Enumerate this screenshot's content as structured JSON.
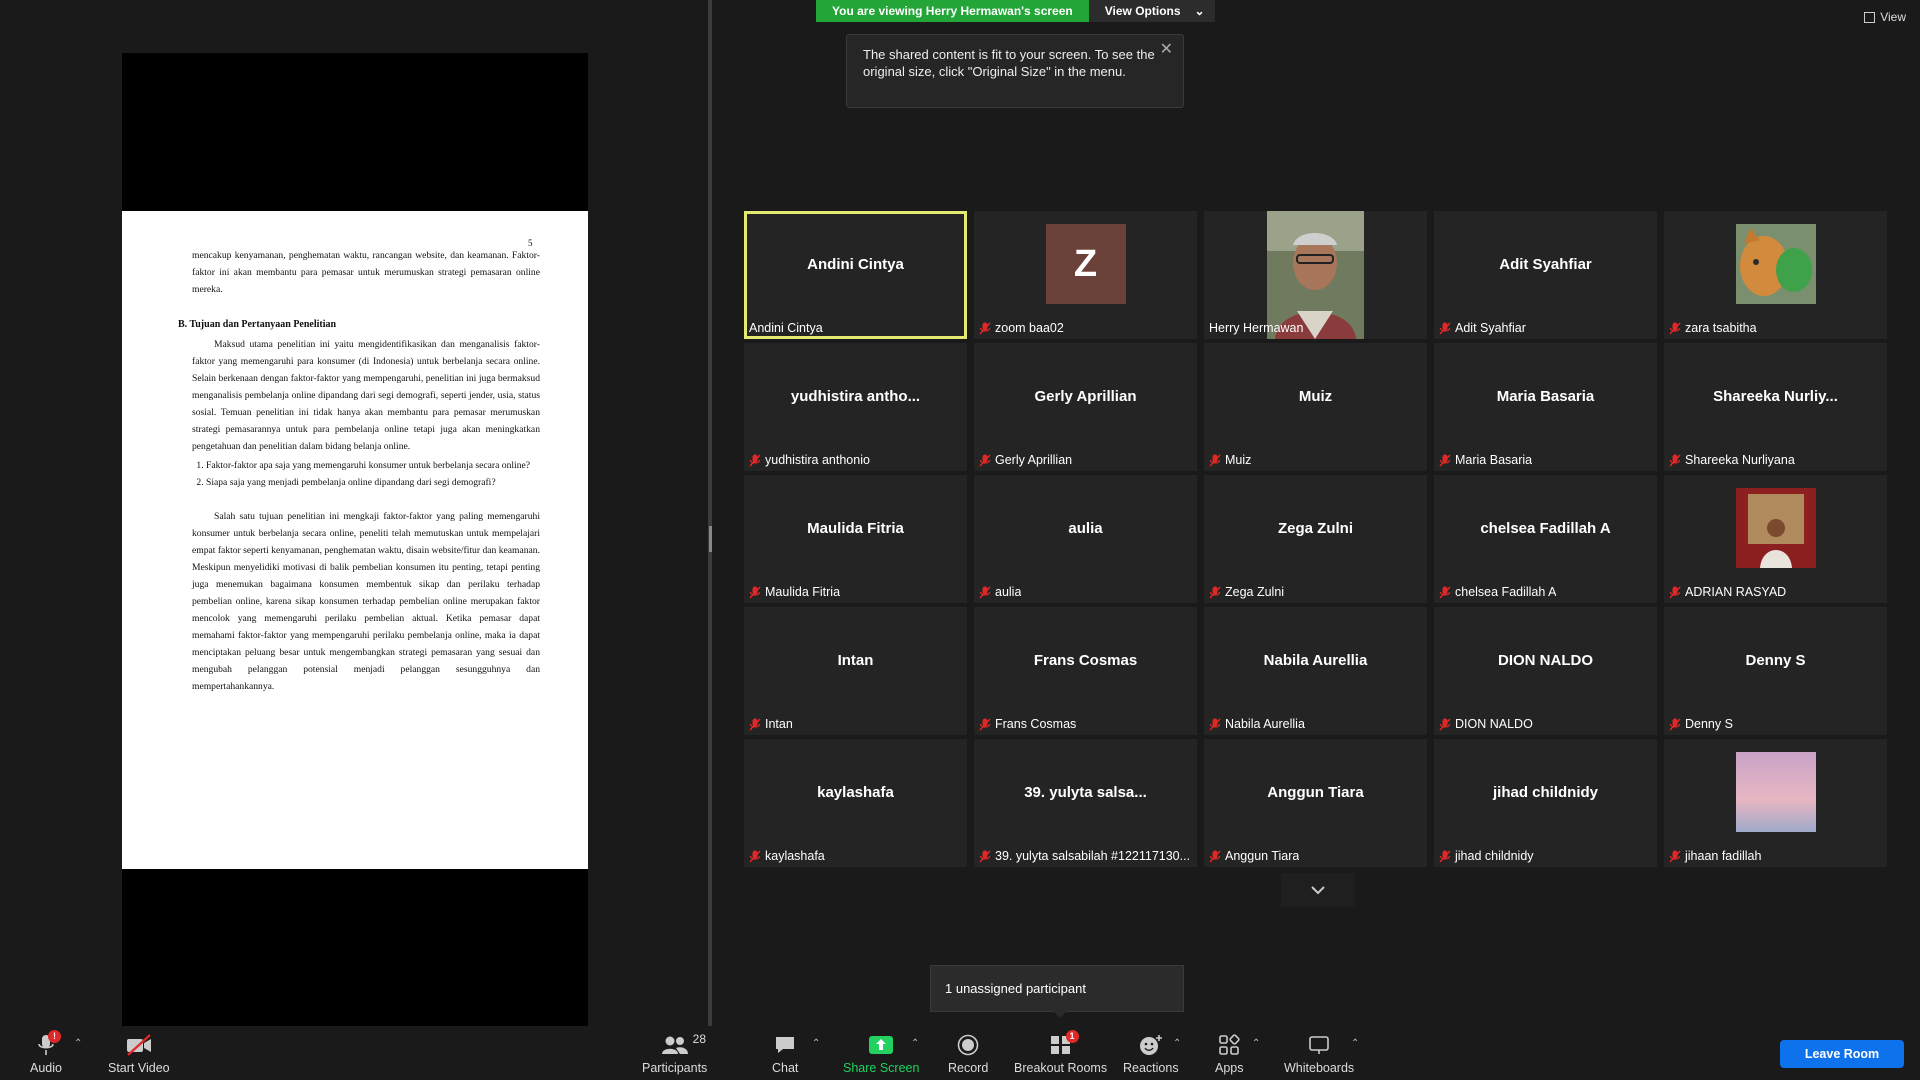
{
  "banner": {
    "viewing": "You are viewing Herry Hermawan's screen",
    "view_options": "View Options"
  },
  "view_button": "View",
  "tooltip": "The shared content is fit to your screen. To see the original size, click \"Original Size\" in the menu.",
  "document": {
    "page_number": "5",
    "para1": "mencakup kenyamanan, penghematan waktu, rancangan website, dan keamanan. Faktor-faktor ini akan membantu para pemasar untuk merumuskan strategi pemasaran online mereka.",
    "heading": "B. Tujuan dan Pertanyaan Penelitian",
    "para2": "Maksud utama penelitian ini yaitu mengidentifikasikan dan menganalisis faktor-faktor yang memengaruhi para konsumer (di Indonesia) untuk berbelanja secara online. Selain berkenaan dengan faktor-faktor yang mempengaruhi, penelitian ini juga bermaksud menganalisis pembelanja online dipandang dari segi demografi, seperti jender, usia, status sosial. Temuan penelitian ini tidak hanya akan membantu para pemasar merumuskan strategi pemasarannya untuk para pembelanja online tetapi juga akan meningkatkan pengetahuan dan penelitian dalam bidang belanja online.",
    "q1": "Faktor-faktor apa saja yang memengaruhi konsumer untuk berbelanja secara online?",
    "q2": "Siapa saja yang menjadi pembelanja online dipandang dari segi demografi?",
    "para3": "Salah satu tujuan penelitian ini mengkaji faktor-faktor yang paling memengaruhi konsumer untuk berbelanja secara online, peneliti telah memutuskan untuk mempelajari empat faktor seperti kenyamanan, penghematan waktu, disain website/fitur dan keamanan. Meskipun menyelidiki motivasi di balik pembelian konsumen itu penting, tetapi penting juga menemukan bagaimana konsumen membentuk sikap dan perilaku terhadap pembelian online, karena sikap konsumen terhadap pembelian online merupakan faktor mencolok yang memengaruhi perilaku pembelian aktual. Ketika pemasar dapat memahami faktor-faktor yang mempengaruhi perilaku pembelanja online, maka ia dapat menciptakan peluang besar untuk mengembangkan strategi pemasaran yang sesuai dan mengubah pelanggan potensial menjadi pelanggan sesungguhnya dan mempertahankannya."
  },
  "participants": [
    {
      "display": "Andini Cintya",
      "label": "Andini Cintya",
      "muted": false,
      "active": true,
      "kind": "name"
    },
    {
      "display": "Z",
      "label": "zoom baa02",
      "muted": true,
      "kind": "avatar"
    },
    {
      "display": "",
      "label": "Herry Hermawan",
      "muted": false,
      "kind": "video"
    },
    {
      "display": "Adit Syahfiar",
      "label": "Adit Syahfiar",
      "muted": true,
      "kind": "name"
    },
    {
      "display": "",
      "label": "zara tsabitha",
      "muted": true,
      "kind": "photo-cat"
    },
    {
      "display": "yudhistira  antho...",
      "label": "yudhistira anthonio",
      "muted": true,
      "kind": "name"
    },
    {
      "display": "Gerly Aprillian",
      "label": "Gerly Aprillian",
      "muted": true,
      "kind": "name"
    },
    {
      "display": "Muiz",
      "label": "Muiz",
      "muted": true,
      "kind": "name"
    },
    {
      "display": "Maria Basaria",
      "label": "Maria Basaria",
      "muted": true,
      "kind": "name"
    },
    {
      "display": "Shareeka  Nurliy...",
      "label": "Shareeka Nurliyana",
      "muted": true,
      "kind": "name"
    },
    {
      "display": "Maulida Fitria",
      "label": "Maulida Fitria",
      "muted": true,
      "kind": "name"
    },
    {
      "display": "aulia",
      "label": "aulia",
      "muted": true,
      "kind": "name"
    },
    {
      "display": "Zega Zulni",
      "label": "Zega Zulni",
      "muted": true,
      "kind": "name"
    },
    {
      "display": "chelsea Fadillah A",
      "label": "chelsea Fadillah A",
      "muted": true,
      "kind": "name"
    },
    {
      "display": "",
      "label": "ADRIAN RASYAD",
      "muted": true,
      "kind": "photo-man"
    },
    {
      "display": "Intan",
      "label": "Intan",
      "muted": true,
      "kind": "name"
    },
    {
      "display": "Frans Cosmas",
      "label": "Frans Cosmas",
      "muted": true,
      "kind": "name"
    },
    {
      "display": "Nabila Aurellia",
      "label": "Nabila Aurellia",
      "muted": true,
      "kind": "name"
    },
    {
      "display": "DION NALDO",
      "label": "DION NALDO",
      "muted": true,
      "kind": "name"
    },
    {
      "display": "Denny S",
      "label": "Denny S",
      "muted": true,
      "kind": "name"
    },
    {
      "display": "kaylashafa",
      "label": "kaylashafa",
      "muted": true,
      "kind": "name"
    },
    {
      "display": "39. yulyta salsa...",
      "label": "39. yulyta salsabilah #122117130...",
      "muted": true,
      "kind": "name"
    },
    {
      "display": "Anggun Tiara",
      "label": "Anggun Tiara",
      "muted": true,
      "kind": "name"
    },
    {
      "display": "jihad childnidy",
      "label": "jihad childnidy",
      "muted": true,
      "kind": "name"
    },
    {
      "display": "",
      "label": "jihaan fadillah",
      "muted": true,
      "kind": "photo-sky"
    }
  ],
  "unassigned": "1 unassigned participant",
  "toolbar": {
    "audio": "Audio",
    "audio_badge": "!",
    "start_video": "Start Video",
    "participants": "Participants",
    "participants_count": "28",
    "chat": "Chat",
    "share_screen": "Share Screen",
    "record": "Record",
    "breakout_rooms": "Breakout Rooms",
    "breakout_badge": "1",
    "reactions": "Reactions",
    "apps": "Apps",
    "whiteboards": "Whiteboards",
    "leave": "Leave Room"
  },
  "colors": {
    "active_speaker": "#e4ea6f",
    "share_green": "#23a538",
    "leave_blue": "#0e72ed",
    "mute_red": "#e02828"
  }
}
